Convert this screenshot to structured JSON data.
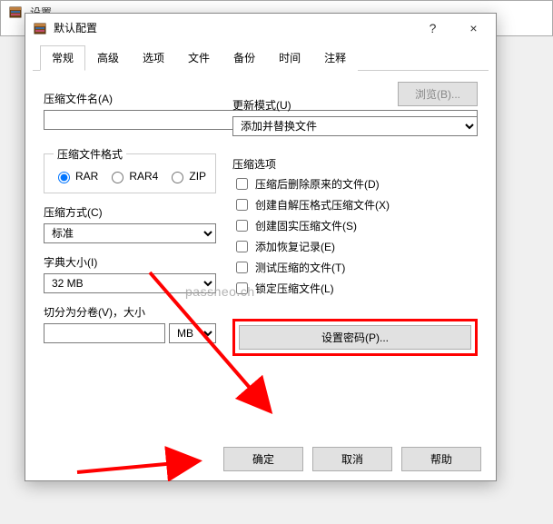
{
  "bg": {
    "title": "设置"
  },
  "dialog": {
    "title": "默认配置",
    "help_char": "?",
    "close_char": "×"
  },
  "tabs": {
    "items": [
      {
        "label": "常规"
      },
      {
        "label": "高级"
      },
      {
        "label": "选项"
      },
      {
        "label": "文件"
      },
      {
        "label": "备份"
      },
      {
        "label": "时间"
      },
      {
        "label": "注释"
      }
    ]
  },
  "fields": {
    "archive_name_label": "压缩文件名(A)",
    "archive_name_value": "",
    "browse_btn": "浏览(B)...",
    "update_mode_label": "更新模式(U)",
    "update_mode_value": "添加并替换文件",
    "format_legend": "压缩文件格式",
    "format_options": [
      "RAR",
      "RAR4",
      "ZIP"
    ],
    "method_label": "压缩方式(C)",
    "method_value": "标准",
    "dict_label": "字典大小(I)",
    "dict_value": "32 MB",
    "split_label": "切分为分卷(V)，大小",
    "split_value": "",
    "split_unit": "MB",
    "options_label": "压缩选项",
    "opt_delete": "压缩后删除原来的文件(D)",
    "opt_sfx": "创建自解压格式压缩文件(X)",
    "opt_solid": "创建固实压缩文件(S)",
    "opt_recovery": "添加恢复记录(E)",
    "opt_test": "测试压缩的文件(T)",
    "opt_lock": "锁定压缩文件(L)",
    "pwd_btn": "设置密码(P)..."
  },
  "footer": {
    "ok": "确定",
    "cancel": "取消",
    "help": "帮助"
  },
  "watermark": "passneo.ch"
}
